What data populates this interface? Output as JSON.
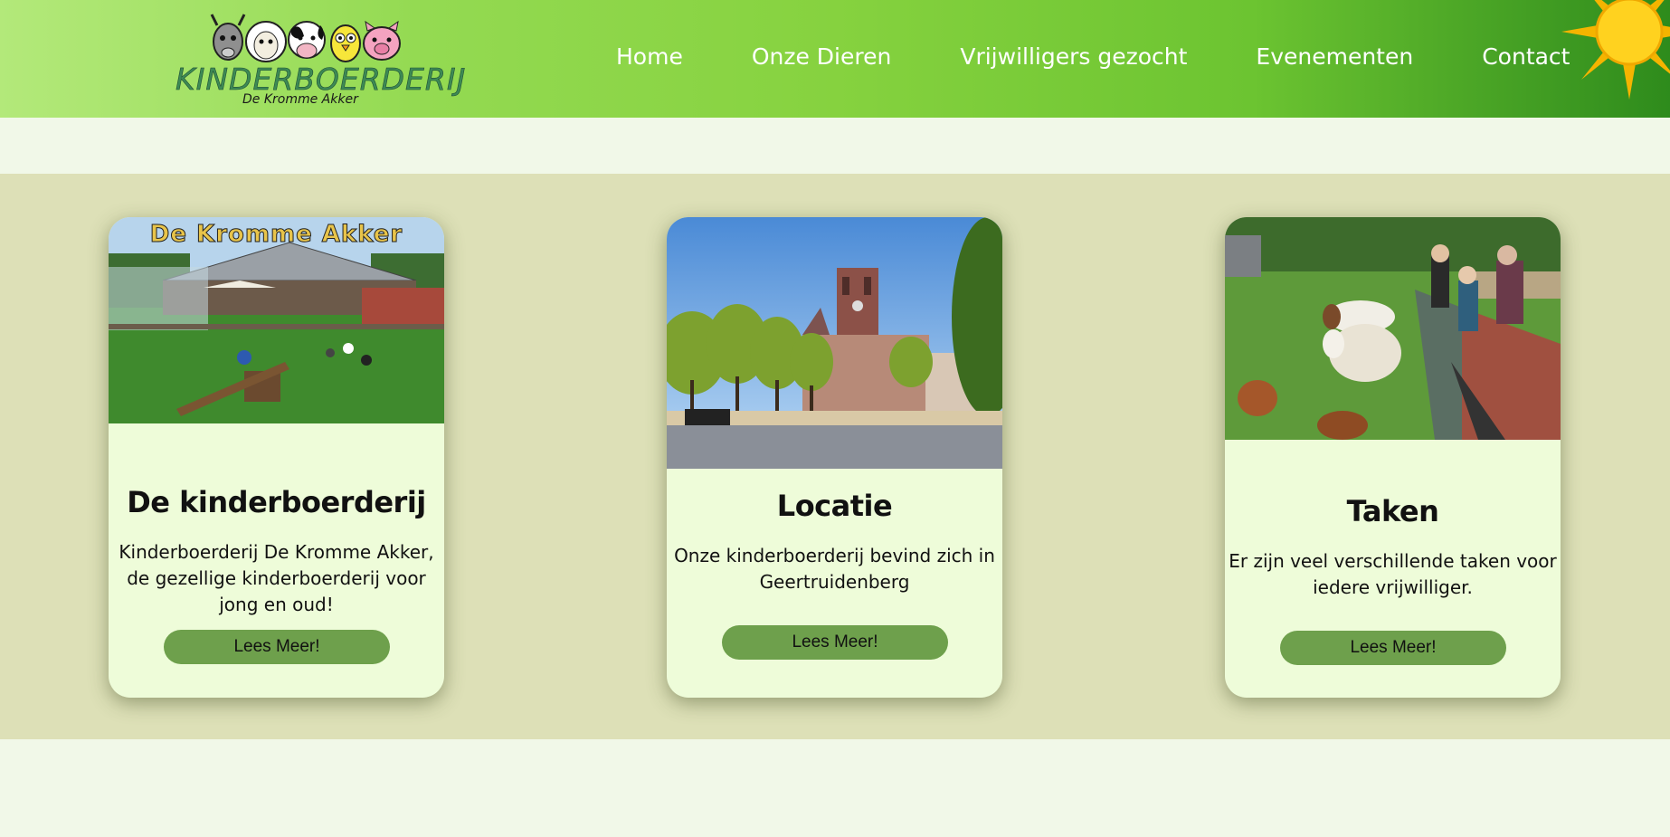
{
  "logo": {
    "title": "KINDERBOERDERIJ",
    "subtitle": "De Kromme Akker"
  },
  "nav": {
    "items": [
      {
        "label": "Home"
      },
      {
        "label": "Onze Dieren"
      },
      {
        "label": "Vrijwilligers gezocht"
      },
      {
        "label": "Evenementen"
      },
      {
        "label": "Contact"
      }
    ]
  },
  "cards": [
    {
      "image_caption": "De Kromme Akker",
      "title": "De kinderboerderij",
      "text": "Kinderboerderij De Kromme Akker, de gezellige kinderboerderij voor jong en oud!",
      "button": "Lees Meer!"
    },
    {
      "title": "Locatie",
      "text": "Onze kinderboerderij bevind zich in Geertruidenberg",
      "button": "Lees Meer!"
    },
    {
      "title": "Taken",
      "text": "Er zijn veel verschillende taken voor iedere vrijwilliger.",
      "button": "Lees Meer!"
    }
  ],
  "colors": {
    "header_gradient_start": "#b3e97a",
    "header_gradient_end": "#2e8b1c",
    "band": "#dde0b7",
    "card_bg": "#eefcd9",
    "button": "#6ea04c",
    "page_bg": "#f1f8e8"
  }
}
